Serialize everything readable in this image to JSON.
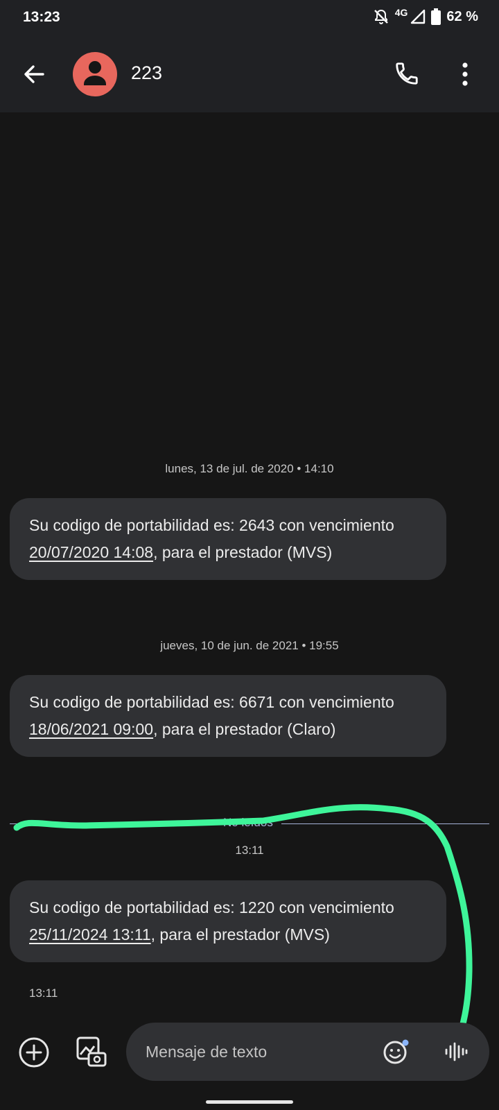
{
  "status_bar": {
    "time": "13:23",
    "network": "4G",
    "battery": "62 %"
  },
  "header": {
    "contact_name": "223",
    "icons": [
      "back-arrow-icon",
      "contact-avatar-icon",
      "phone-call-icon",
      "more-vert-icon"
    ]
  },
  "conversation": {
    "groups": [
      {
        "date_header": "lunes, 13 de jul. de 2020 • 14:10",
        "message": {
          "before": "Su codigo de portabilidad es: 2643 con vencimiento ",
          "link": "20/07/2020 14:08",
          "after": ", para el prestador (MVS)"
        }
      },
      {
        "date_header": "jueves, 10 de jun. de 2021 • 19:55",
        "message": {
          "before": "Su codigo de portabilidad es: 6671 con vencimiento ",
          "link": "18/06/2021 09:00",
          "after": ", para el prestador (Claro)"
        }
      },
      {
        "date_header": "13:11",
        "message": {
          "before": "Su codigo de portabilidad es: 1220 con vencimiento ",
          "link": "25/11/2024 13:11",
          "after": ", para el prestador (MVS)"
        },
        "sent_time": "13:11"
      }
    ],
    "unread_divider": "No leídos"
  },
  "composer": {
    "placeholder": "Mensaje de texto",
    "icons": [
      "add-circle-icon",
      "gallery-camera-icon",
      "emoji-icon",
      "voice-waveform-icon"
    ]
  },
  "colors": {
    "background": "#161616",
    "bars": "#202124",
    "bubble": "#303134",
    "avatar": "#e8675d",
    "unread": "#a7b4d9",
    "annotation": "#3ef59a"
  }
}
